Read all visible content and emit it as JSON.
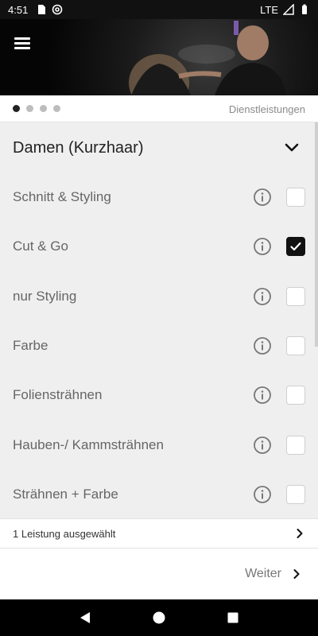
{
  "status_bar": {
    "time": "4:51",
    "network": "LTE",
    "icons": [
      "sd-card-icon",
      "at-sign-icon",
      "signal-icon",
      "battery-icon"
    ]
  },
  "header": {
    "menu_icon": "menu-icon",
    "hero_image": "salon-photo"
  },
  "pager": {
    "pages": 4,
    "active_index": 0,
    "label": "Dienstleistungen"
  },
  "section": {
    "title": "Damen (Kurzhaar)",
    "expand_icon": "chevron-down-icon"
  },
  "services": [
    {
      "label": "Schnitt & Styling",
      "checked": false
    },
    {
      "label": "Cut & Go",
      "checked": true
    },
    {
      "label": "nur Styling",
      "checked": false
    },
    {
      "label": "Farbe",
      "checked": false
    },
    {
      "label": "Foliensträhnen",
      "checked": false
    },
    {
      "label": "Hauben-/ Kammsträhnen",
      "checked": false
    },
    {
      "label": "Strähnen + Farbe",
      "checked": false
    }
  ],
  "summary": {
    "text": "1 Leistung ausgewählt"
  },
  "footer": {
    "next_label": "Weiter"
  },
  "colors": {
    "accent": "#111111",
    "background": "#efefef"
  }
}
